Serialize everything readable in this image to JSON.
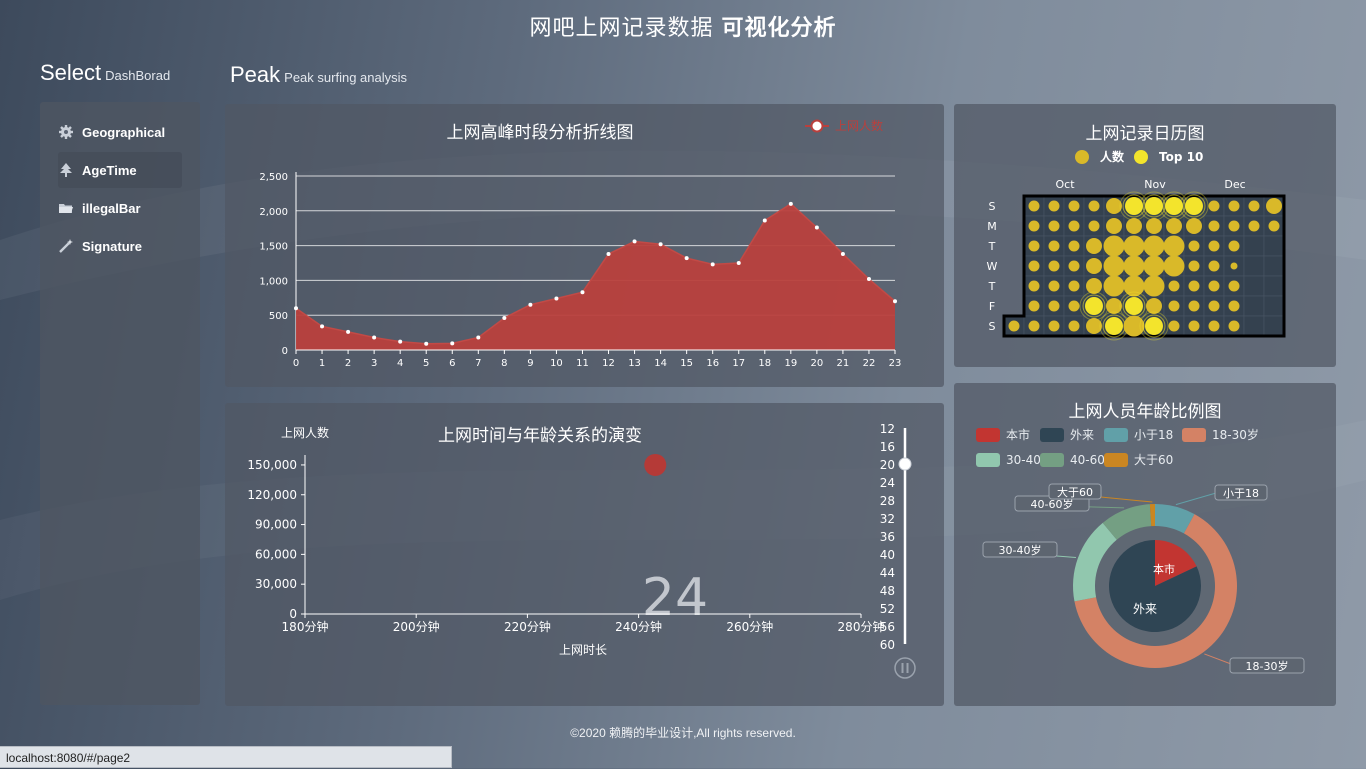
{
  "header": {
    "title_plain": "网吧上网记录数据 ",
    "title_bold": "可视化分析"
  },
  "select": {
    "big": "Select",
    "small": "DashBorad"
  },
  "peak": {
    "big": "Peak",
    "small": "Peak surfing analysis"
  },
  "menu": [
    {
      "label": "Geographical",
      "icon": "gear-icon"
    },
    {
      "label": "AgeTime",
      "icon": "tree-icon"
    },
    {
      "label": "illegalBar",
      "icon": "folder-icon"
    },
    {
      "label": "Signature",
      "icon": "magic-wand-icon"
    }
  ],
  "colors": {
    "line_fill": "#b9403d",
    "calendar_yellow": "#d9b929",
    "calendar_top": "#f3e42c",
    "pie_local": "#c23531",
    "pie_outside": "#2f4554"
  },
  "chart_data": [
    {
      "type": "area",
      "title": "上网高峰时段分析折线图",
      "legend": [
        "上网人数"
      ],
      "legend_position": "top-right",
      "x": [
        0,
        1,
        2,
        3,
        4,
        5,
        6,
        7,
        8,
        9,
        10,
        11,
        12,
        13,
        14,
        15,
        16,
        17,
        18,
        19,
        20,
        21,
        22,
        23
      ],
      "series": [
        {
          "name": "上网人数",
          "values": [
            600,
            340,
            260,
            180,
            120,
            90,
            95,
            180,
            460,
            650,
            740,
            830,
            1380,
            1560,
            1520,
            1320,
            1230,
            1250,
            1860,
            2100,
            1760,
            1380,
            1020,
            700
          ]
        }
      ],
      "ylim": [
        0,
        2500
      ],
      "yticks": [
        "0",
        "500",
        "1,000",
        "1,500",
        "2,000",
        "2,500"
      ],
      "grid": true
    },
    {
      "type": "scatter",
      "title": "上网时间与年龄关系的演变",
      "ylabel": "上网人数",
      "xlabel": "上网时长",
      "xticks": [
        "180分钟",
        "200分钟",
        "220分钟",
        "240分钟",
        "260分钟",
        "280分钟"
      ],
      "xlim": [
        180,
        280
      ],
      "yticks": [
        "0",
        "30,000",
        "60,000",
        "90,000",
        "120,000",
        "150,000"
      ],
      "ylim": [
        0,
        160000
      ],
      "points": [
        {
          "x": 243,
          "y": 150000
        }
      ],
      "timeline": {
        "values": [
          "12",
          "16",
          "20",
          "24",
          "28",
          "32",
          "36",
          "40",
          "44",
          "48",
          "52",
          "56",
          "60"
        ],
        "current": "20",
        "watermark": "24"
      }
    },
    {
      "type": "heatmap",
      "title": "上网记录日历图",
      "legend": [
        "人数",
        "Top 10"
      ],
      "legend_position": "top",
      "months": [
        "Oct",
        "Nov",
        "Dec"
      ],
      "weekdays": [
        "S",
        "M",
        "T",
        "W",
        "T",
        "F",
        "S"
      ],
      "values": [
        [
          null,
          1,
          1,
          1,
          1,
          2,
          4,
          4,
          4,
          4,
          1,
          1,
          1,
          2
        ],
        [
          null,
          1,
          1,
          1,
          1,
          2,
          2,
          2,
          2,
          2,
          1,
          1,
          1,
          1
        ],
        [
          null,
          1,
          1,
          1,
          2,
          3,
          3,
          3,
          3,
          1,
          1,
          1,
          null,
          null
        ],
        [
          null,
          1,
          1,
          1,
          2,
          3,
          3,
          3,
          3,
          1,
          1,
          0.5,
          null,
          null
        ],
        [
          null,
          1,
          1,
          1,
          2,
          3,
          3,
          3,
          1,
          1,
          1,
          1,
          null,
          null
        ],
        [
          null,
          1,
          1,
          1,
          4,
          2,
          4,
          2,
          1,
          1,
          1,
          1,
          null,
          null
        ],
        [
          1,
          1,
          1,
          1,
          2,
          4,
          3,
          4,
          1,
          1,
          1,
          1,
          null,
          null
        ]
      ]
    },
    {
      "type": "pie",
      "title": "上网人员年龄比例图",
      "legend": [
        "本市",
        "外来",
        "小于18",
        "18-30岁",
        "30-40岁",
        "40-60岁",
        "大于60"
      ],
      "legend_position": "top-left",
      "inner": [
        {
          "name": "本市",
          "value": 18
        },
        {
          "name": "外来",
          "value": 82
        }
      ],
      "outer": [
        {
          "name": "小于18",
          "value": 8
        },
        {
          "name": "18-30岁",
          "value": 64
        },
        {
          "name": "30-40岁",
          "value": 17
        },
        {
          "name": "40-60岁",
          "value": 10
        },
        {
          "name": "大于60",
          "value": 1
        }
      ],
      "colors": [
        "#c23531",
        "#2f4554",
        "#61a0a8",
        "#d48265",
        "#91c7ae",
        "#749f83",
        "#ca8622"
      ]
    }
  ],
  "footer": "©2020 赖腾的毕业设计,All rights reserved.",
  "status_bar": "localhost:8080/#/page2"
}
